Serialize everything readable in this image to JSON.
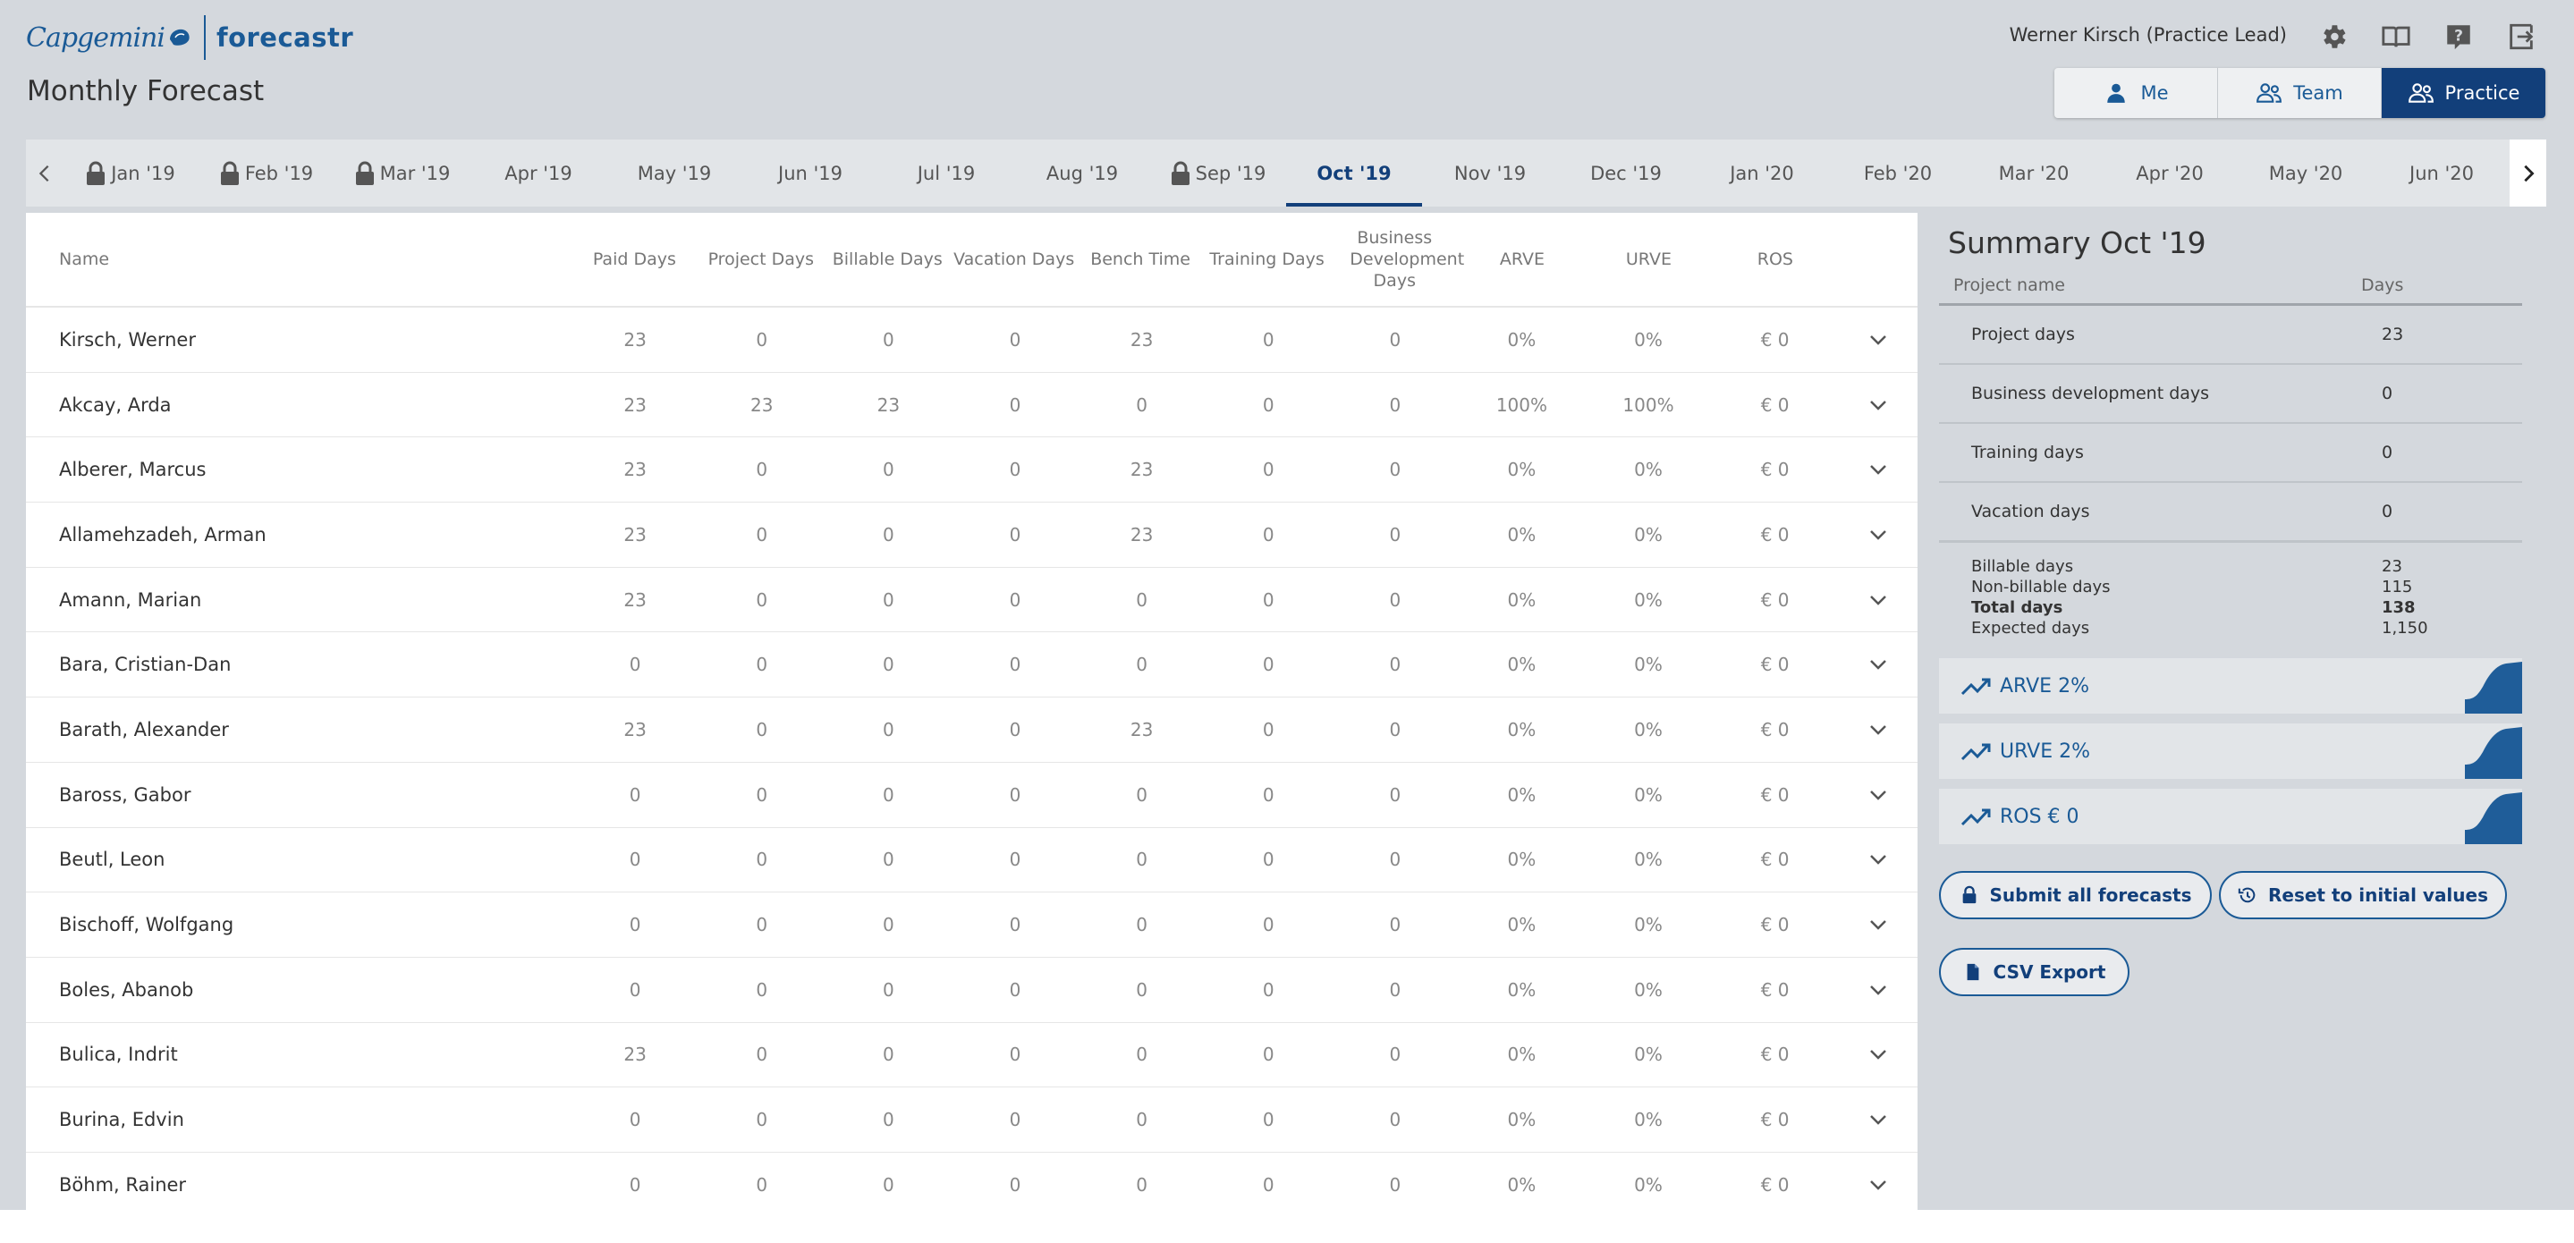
{
  "app": {
    "logo_brand": "Capgemini",
    "logo_app": "forecastr",
    "page_title": "Monthly Forecast",
    "user": "Werner Kirsch (Practice Lead)"
  },
  "header_icons": [
    "gear-icon",
    "book-icon",
    "help-icon",
    "logout-icon"
  ],
  "view_tabs": [
    {
      "label": "Me",
      "icon": "person-icon",
      "active": false
    },
    {
      "label": "Team",
      "icon": "people-icon",
      "active": false
    },
    {
      "label": "Practice",
      "icon": "people-icon",
      "active": true
    }
  ],
  "months": [
    {
      "label": "Jan '19",
      "locked": true
    },
    {
      "label": "Feb '19",
      "locked": true
    },
    {
      "label": "Mar '19",
      "locked": true
    },
    {
      "label": "Apr '19",
      "locked": false
    },
    {
      "label": "May '19",
      "locked": false
    },
    {
      "label": "Jun '19",
      "locked": false
    },
    {
      "label": "Jul '19",
      "locked": false
    },
    {
      "label": "Aug '19",
      "locked": false
    },
    {
      "label": "Sep '19",
      "locked": true
    },
    {
      "label": "Oct '19",
      "locked": false,
      "active": true
    },
    {
      "label": "Nov '19",
      "locked": false
    },
    {
      "label": "Dec '19",
      "locked": false
    },
    {
      "label": "Jan '20",
      "locked": false
    },
    {
      "label": "Feb '20",
      "locked": false
    },
    {
      "label": "Mar '20",
      "locked": false
    },
    {
      "label": "Apr '20",
      "locked": false
    },
    {
      "label": "May '20",
      "locked": false
    },
    {
      "label": "Jun '20",
      "locked": false
    }
  ],
  "table": {
    "columns": [
      "Name",
      "Paid Days",
      "Project Days",
      "Billable Days",
      "Vacation Days",
      "Bench Time",
      "Training Days",
      "Business Development Days",
      "ARVE",
      "URVE",
      "ROS"
    ],
    "rows": [
      [
        "Kirsch, Werner",
        "23",
        "0",
        "0",
        "0",
        "23",
        "0",
        "0",
        "0%",
        "0%",
        "€ 0"
      ],
      [
        "Akcay, Arda",
        "23",
        "23",
        "23",
        "0",
        "0",
        "0",
        "0",
        "100%",
        "100%",
        "€ 0"
      ],
      [
        "Alberer, Marcus",
        "23",
        "0",
        "0",
        "0",
        "23",
        "0",
        "0",
        "0%",
        "0%",
        "€ 0"
      ],
      [
        "Allamehzadeh, Arman",
        "23",
        "0",
        "0",
        "0",
        "23",
        "0",
        "0",
        "0%",
        "0%",
        "€ 0"
      ],
      [
        "Amann, Marian",
        "23",
        "0",
        "0",
        "0",
        "0",
        "0",
        "0",
        "0%",
        "0%",
        "€ 0"
      ],
      [
        "Bara, Cristian-Dan",
        "0",
        "0",
        "0",
        "0",
        "0",
        "0",
        "0",
        "0%",
        "0%",
        "€ 0"
      ],
      [
        "Barath, Alexander",
        "23",
        "0",
        "0",
        "0",
        "23",
        "0",
        "0",
        "0%",
        "0%",
        "€ 0"
      ],
      [
        "Baross, Gabor",
        "0",
        "0",
        "0",
        "0",
        "0",
        "0",
        "0",
        "0%",
        "0%",
        "€ 0"
      ],
      [
        "Beutl, Leon",
        "0",
        "0",
        "0",
        "0",
        "0",
        "0",
        "0",
        "0%",
        "0%",
        "€ 0"
      ],
      [
        "Bischoff, Wolfgang",
        "0",
        "0",
        "0",
        "0",
        "0",
        "0",
        "0",
        "0%",
        "0%",
        "€ 0"
      ],
      [
        "Boles, Abanob",
        "0",
        "0",
        "0",
        "0",
        "0",
        "0",
        "0",
        "0%",
        "0%",
        "€ 0"
      ],
      [
        "Bulica, Indrit",
        "23",
        "0",
        "0",
        "0",
        "0",
        "0",
        "0",
        "0%",
        "0%",
        "€ 0"
      ],
      [
        "Burina, Edvin",
        "0",
        "0",
        "0",
        "0",
        "0",
        "0",
        "0",
        "0%",
        "0%",
        "€ 0"
      ],
      [
        "Böhm, Rainer",
        "0",
        "0",
        "0",
        "0",
        "0",
        "0",
        "0",
        "0%",
        "0%",
        "€ 0"
      ]
    ]
  },
  "summary": {
    "title": "Summary Oct '19",
    "head": {
      "name": "Project name",
      "days": "Days"
    },
    "rows": [
      {
        "label": "Project days",
        "value": "23"
      },
      {
        "label": "Business development days",
        "value": "0"
      },
      {
        "label": "Training days",
        "value": "0"
      },
      {
        "label": "Vacation days",
        "value": "0"
      }
    ],
    "totals": [
      {
        "label": "Billable days",
        "value": "23",
        "bold": false
      },
      {
        "label": "Non-billable days",
        "value": "115",
        "bold": false
      },
      {
        "label": "Total days",
        "value": "138",
        "bold": true
      },
      {
        "label": "Expected days",
        "value": "1,150",
        "bold": false
      }
    ],
    "kpis": [
      "ARVE 2%",
      "URVE 2%",
      "ROS € 0"
    ],
    "buttons": {
      "submit": "Submit all forecasts",
      "reset": "Reset to initial values",
      "csv": "CSV Export"
    }
  },
  "colors": {
    "brand": "#1a5a96",
    "active_tab": "#123f7a",
    "background": "#d4d8dd"
  }
}
